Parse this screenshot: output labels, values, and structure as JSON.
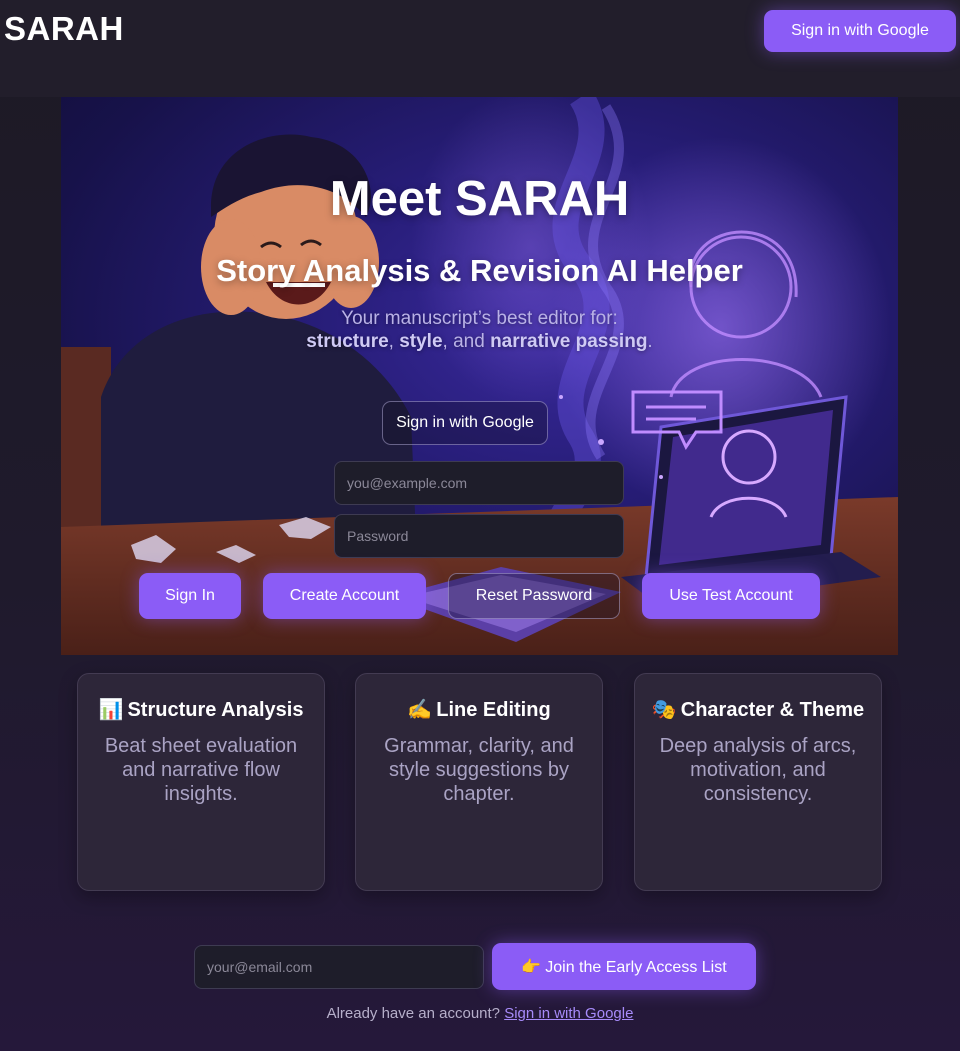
{
  "header": {
    "brand": "SARAH",
    "google_button": "Sign in with Google"
  },
  "hero": {
    "title": "Meet SARAH",
    "subtitle": "Story Analysis & Revision AI Helper",
    "tagline_prefix": "Your manuscript’s best editor for:",
    "tagline_structure": "structure",
    "tagline_comma": ",",
    "tagline_style": "style",
    "tagline_and": ", and",
    "tagline_narrative": "narrative passing",
    "tagline_period": ".",
    "google_button": "Sign in with Google",
    "email_placeholder": "you@example.com",
    "password_placeholder": "Password",
    "buttons": {
      "sign_in": "Sign In",
      "create_account": "Create Account",
      "reset_password": "Reset Password",
      "test_account": "Use Test Account"
    }
  },
  "features": [
    {
      "icon": "📊",
      "icon_name": "bar-chart-icon",
      "title": "Structure Analysis",
      "description": "Beat sheet evaluation and narrative flow insights."
    },
    {
      "icon": "✍️",
      "icon_name": "writing-hand-icon",
      "title": "Line Editing",
      "description": "Grammar, clarity, and style suggestions by chapter."
    },
    {
      "icon": "🎭",
      "icon_name": "theater-masks-icon",
      "title": "Character & Theme",
      "description": "Deep analysis of arcs, motivation, and consistency."
    }
  ],
  "signup": {
    "email_placeholder": "your@email.com",
    "join_icon": "👉",
    "join_label": "Join the Early Access List",
    "already_text": "Already have an account?",
    "already_link": "Sign in with Google"
  },
  "colors": {
    "accent": "#8b5cf6",
    "link": "#a78bfa",
    "background": "#1d1a25",
    "card": "#2d2639"
  }
}
